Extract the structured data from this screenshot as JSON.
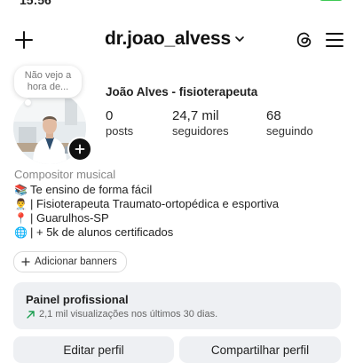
{
  "status_bar": {
    "time": "15:56"
  },
  "header": {
    "username": "dr.joao_alvess"
  },
  "note": {
    "text": "Não vejo a hora de..."
  },
  "profile": {
    "full_name": "João Alves - fisioterapeuta"
  },
  "stats": [
    {
      "value": "0",
      "label": "posts"
    },
    {
      "value": "24,7 mil",
      "label": "seguidores"
    },
    {
      "value": "68",
      "label": "seguindo"
    }
  ],
  "bio": {
    "category": "Compositor musical",
    "lines": [
      {
        "emoji": "📚",
        "text": "Te ensino de forma fácil"
      },
      {
        "emoji": "👨‍⚕️",
        "text": "| Fisioterapeuta Traumato-ortopédica e esportiva"
      },
      {
        "emoji": "📍",
        "text": "| Guarulhos-SP"
      },
      {
        "emoji": "🌐",
        "text": "| + 5k de alunos certificados"
      }
    ]
  },
  "banners": {
    "label": "Adicionar banners"
  },
  "professional_panel": {
    "title": "Painel profissional",
    "subtitle": "2,1 mil visualizações nos últimos 30 dias."
  },
  "actions": {
    "edit": "Editar perfil",
    "share": "Compartilhar perfil"
  },
  "colors": {
    "accent_green": "#1a9e4f",
    "battery": "#3ec954",
    "panel_bg": "#eef0f3"
  },
  "icons": [
    "plus-icon",
    "chevron-down-icon",
    "threads-icon",
    "menu-icon",
    "add-story-icon",
    "trend-up-icon"
  ]
}
